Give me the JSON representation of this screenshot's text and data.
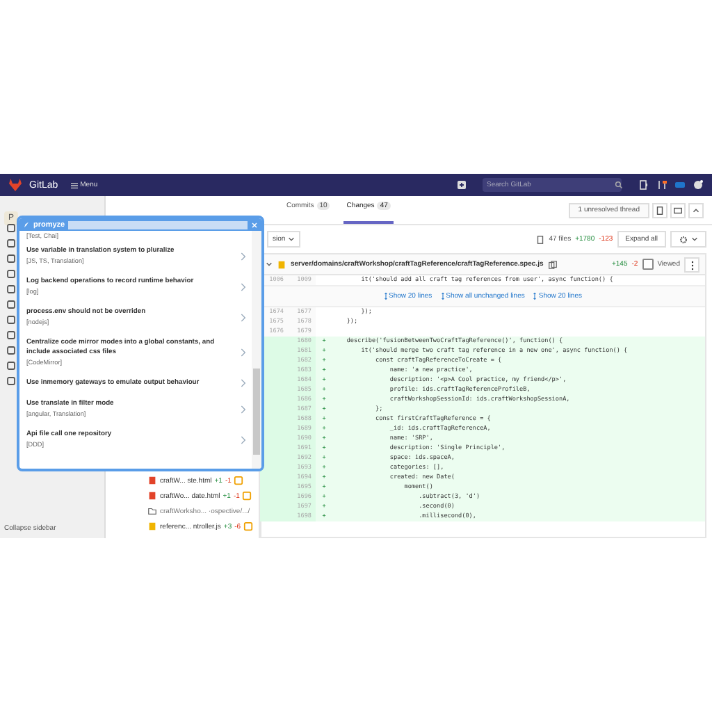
{
  "navbar": {
    "brand": "GitLab",
    "menu": "Menu",
    "search_placeholder": "Search GitLab"
  },
  "sidebar": {
    "avatar": "P",
    "collapse": "Collapse sidebar"
  },
  "tabs": [
    {
      "label": "Commits",
      "count": "10",
      "selected": false
    },
    {
      "label": "Changes",
      "count": "47",
      "selected": true
    }
  ],
  "thread_button": "1 unresolved thread",
  "compare_dropdown": "sion",
  "stats": {
    "files": "47 files",
    "added": "+1780",
    "removed": "-123"
  },
  "expand_all": "Expand all",
  "file_tree": [
    {
      "kind": "html",
      "name": "craftW... ste.html",
      "added": "+1",
      "removed": "-1"
    },
    {
      "kind": "html",
      "name": "craftWo... date.html",
      "added": "+1",
      "removed": "-1"
    },
    {
      "kind": "folder",
      "name": "craftWorksho... ·ospective/.../"
    },
    {
      "kind": "js",
      "name": "referenc... ntroller.js",
      "added": "+3",
      "removed": "-6"
    }
  ],
  "file": {
    "path": "server/domains/craftWorkshop/craftTagReference/craftTagReference.spec.js",
    "added": "+145",
    "removed": "-2",
    "viewed_label": "Viewed",
    "viewed": false
  },
  "diff_rows": [
    {
      "kind": "context",
      "old": "1006",
      "new": "1009",
      "code": "        it('should add all craft tag references from user', async function() {"
    },
    {
      "kind": "expand",
      "links": [
        "Show 20 lines",
        "Show all unchanged lines",
        "Show 20 lines"
      ]
    },
    {
      "kind": "context",
      "old": "1674",
      "new": "1677",
      "code": "        });"
    },
    {
      "kind": "context",
      "old": "1675",
      "new": "1678",
      "code": "    });"
    },
    {
      "kind": "context",
      "old": "1676",
      "new": "1679"
    },
    {
      "kind": "added",
      "new": "1680",
      "sign": "+",
      "code": "    describe('fusionBetweenTwoCraftTagReference()', function() {"
    },
    {
      "kind": "added",
      "new": "1681",
      "sign": "+",
      "code": "        it('should merge two craft tag reference in a new one', async function() {"
    },
    {
      "kind": "added",
      "new": "1682",
      "sign": "+",
      "code": "            const craftTagReferenceToCreate = {"
    },
    {
      "kind": "added",
      "new": "1683",
      "sign": "+",
      "code": "                name: 'a new practice',"
    },
    {
      "kind": "added",
      "new": "1684",
      "sign": "+",
      "code": "                description: '<p>A Cool practice, my friend</p>',"
    },
    {
      "kind": "added",
      "new": "1685",
      "sign": "+",
      "code": "                profile: ids.craftTagReferenceProfileB,"
    },
    {
      "kind": "added",
      "new": "1686",
      "sign": "+",
      "code": "                craftWorkshopSessionId: ids.craftWorkshopSessionA,"
    },
    {
      "kind": "added",
      "new": "1687",
      "sign": "+",
      "code": "            };"
    },
    {
      "kind": "added",
      "new": "1688",
      "sign": "+",
      "code": "            const firstCraftTagReference = {"
    },
    {
      "kind": "added",
      "new": "1689",
      "sign": "+",
      "code": "                _id: ids.craftTagReferenceA,"
    },
    {
      "kind": "added",
      "new": "1690",
      "sign": "+",
      "code": "                name: 'SRP',"
    },
    {
      "kind": "added",
      "new": "1691",
      "sign": "+",
      "code": "                description: 'Single Principle',"
    },
    {
      "kind": "added",
      "new": "1692",
      "sign": "+",
      "code": "                space: ids.spaceA,"
    },
    {
      "kind": "added",
      "new": "1693",
      "sign": "+",
      "code": "                categories: [],"
    },
    {
      "kind": "added",
      "new": "1694",
      "sign": "+",
      "code": "                created: new Date("
    },
    {
      "kind": "added",
      "new": "1695",
      "sign": "+",
      "code": "                    moment()"
    },
    {
      "kind": "added",
      "new": "1696",
      "sign": "+",
      "code": "                        .subtract(3, 'd')"
    },
    {
      "kind": "added",
      "new": "1697",
      "sign": "+",
      "code": "                        .second(0)"
    },
    {
      "kind": "added",
      "new": "1698",
      "sign": "+",
      "code": "                        .millisecond(0),"
    }
  ],
  "popup": {
    "brand": "promyze",
    "partial_tags": "[Test, Chai]",
    "items": [
      {
        "title": "Use variable in translation system to pluralize",
        "tags": "[JS, TS, Translation]"
      },
      {
        "title": "Log backend operations to record runtime behavior",
        "tags": "[log]"
      },
      {
        "title": "process.env should not be overriden",
        "tags": "[nodejs]"
      },
      {
        "title": "Centralize code mirror modes into a global constants, and include associated css files",
        "tags": "[CodeMirror]"
      },
      {
        "title": "Use inmemory gateways to emulate output behaviour"
      },
      {
        "title": "Use translate in filter mode",
        "tags": "[angular, Translation]"
      },
      {
        "title": "Api file call one repository",
        "tags": "[DDD]"
      }
    ]
  }
}
